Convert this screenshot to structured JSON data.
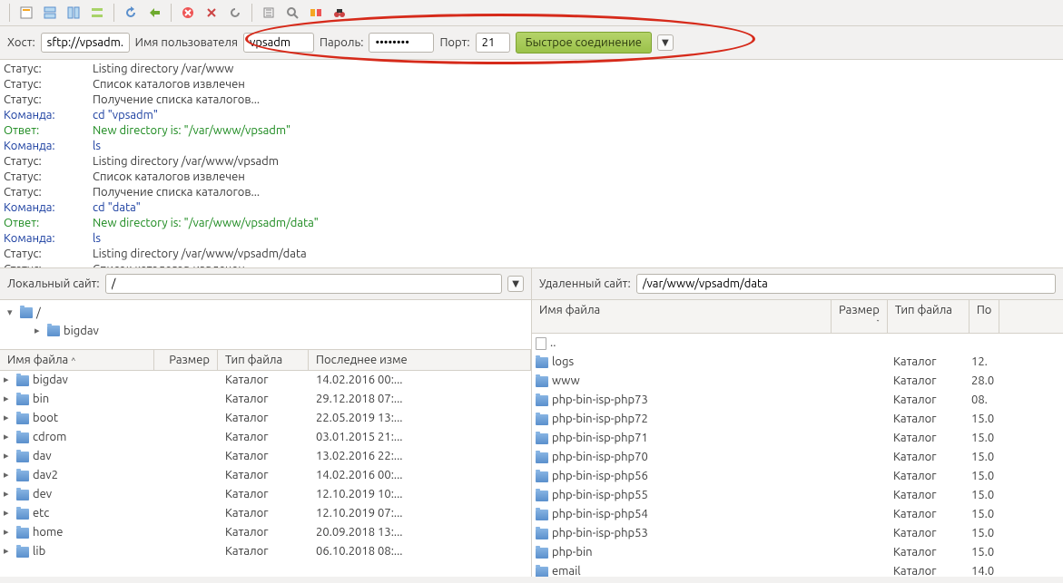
{
  "quickconnect": {
    "host_label": "Хост:",
    "host_value": "sftp://vpsadm.",
    "user_label": "Имя пользователя",
    "user_value": "vpsadm",
    "pass_label": "Пароль:",
    "pass_value": "••••••••",
    "port_label": "Порт:",
    "port_value": "21",
    "connect_label": "Быстрое соединение"
  },
  "log": [
    {
      "cls": "c-status",
      "lbl": "Статус:",
      "msg": "Listing directory /var/www"
    },
    {
      "cls": "c-status",
      "lbl": "Статус:",
      "msg": "Список каталогов извлечен"
    },
    {
      "cls": "c-status",
      "lbl": "Статус:",
      "msg": "Получение списка каталогов..."
    },
    {
      "cls": "c-cmd",
      "lbl": "Команда:",
      "msg": "cd \"vpsadm\""
    },
    {
      "cls": "c-resp",
      "lbl": "Ответ:",
      "msg": "New directory is: \"/var/www/vpsadm\""
    },
    {
      "cls": "c-cmd",
      "lbl": "Команда:",
      "msg": "ls"
    },
    {
      "cls": "c-status",
      "lbl": "Статус:",
      "msg": "Listing directory /var/www/vpsadm"
    },
    {
      "cls": "c-status",
      "lbl": "Статус:",
      "msg": "Список каталогов извлечен"
    },
    {
      "cls": "c-status",
      "lbl": "Статус:",
      "msg": "Получение списка каталогов..."
    },
    {
      "cls": "c-cmd",
      "lbl": "Команда:",
      "msg": "cd \"data\""
    },
    {
      "cls": "c-resp",
      "lbl": "Ответ:",
      "msg": "New directory is: \"/var/www/vpsadm/data\""
    },
    {
      "cls": "c-cmd",
      "lbl": "Команда:",
      "msg": "ls"
    },
    {
      "cls": "c-status",
      "lbl": "Статус:",
      "msg": "Listing directory /var/www/vpsadm/data"
    },
    {
      "cls": "c-status",
      "lbl": "Статус:",
      "msg": "Список каталогов извлечен"
    }
  ],
  "local": {
    "path_label": "Локальный сайт:",
    "path_value": "/",
    "tree_root": "/",
    "tree_item": "bigdav",
    "headers": {
      "name": "Имя файла",
      "size": "Размер",
      "type": "Тип файла",
      "mod": "Последнее изме"
    },
    "files": [
      {
        "name": "bigdav",
        "type": "Каталог",
        "mod": "14.02.2016 00:..."
      },
      {
        "name": "bin",
        "type": "Каталог",
        "mod": "29.12.2018 07:..."
      },
      {
        "name": "boot",
        "type": "Каталог",
        "mod": "22.05.2019 13:..."
      },
      {
        "name": "cdrom",
        "type": "Каталог",
        "mod": "03.01.2015 21:..."
      },
      {
        "name": "dav",
        "type": "Каталог",
        "mod": "13.02.2016 22:..."
      },
      {
        "name": "dav2",
        "type": "Каталог",
        "mod": "14.02.2016 00:..."
      },
      {
        "name": "dev",
        "type": "Каталог",
        "mod": "12.10.2019 10:..."
      },
      {
        "name": "etc",
        "type": "Каталог",
        "mod": "12.10.2019 07:..."
      },
      {
        "name": "home",
        "type": "Каталог",
        "mod": "20.09.2018 13:..."
      },
      {
        "name": "lib",
        "type": "Каталог",
        "mod": "06.10.2018 08:..."
      }
    ]
  },
  "remote": {
    "path_label": "Удаленный сайт:",
    "path_value": "/var/www/vpsadm/data",
    "headers": {
      "name": "Имя файла",
      "size": "Размер",
      "type": "Тип файла",
      "mod": "По"
    },
    "files": [
      {
        "name": "..",
        "type": "",
        "mod": ""
      },
      {
        "name": "logs",
        "type": "Каталог",
        "mod": "12."
      },
      {
        "name": "www",
        "type": "Каталог",
        "mod": "28.0"
      },
      {
        "name": "php-bin-isp-php73",
        "type": "Каталог",
        "mod": "08."
      },
      {
        "name": "php-bin-isp-php72",
        "type": "Каталог",
        "mod": "15.0"
      },
      {
        "name": "php-bin-isp-php71",
        "type": "Каталог",
        "mod": "15.0"
      },
      {
        "name": "php-bin-isp-php70",
        "type": "Каталог",
        "mod": "15.0"
      },
      {
        "name": "php-bin-isp-php56",
        "type": "Каталог",
        "mod": "15.0"
      },
      {
        "name": "php-bin-isp-php55",
        "type": "Каталог",
        "mod": "15.0"
      },
      {
        "name": "php-bin-isp-php54",
        "type": "Каталог",
        "mod": "15.0"
      },
      {
        "name": "php-bin-isp-php53",
        "type": "Каталог",
        "mod": "15.0"
      },
      {
        "name": "php-bin",
        "type": "Каталог",
        "mod": "15.0"
      },
      {
        "name": "email",
        "type": "Каталог",
        "mod": "14.0"
      }
    ]
  }
}
